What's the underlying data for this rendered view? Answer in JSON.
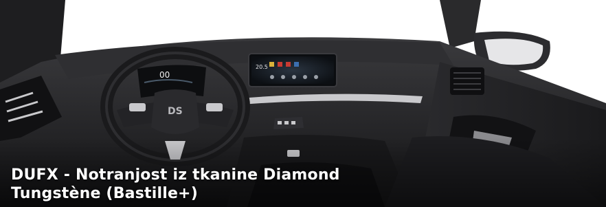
{
  "caption": {
    "line1": "DUFX - Notranjost iz tkanine Diamond",
    "line2": "Tungstène (Bastille+)"
  },
  "cluster": {
    "speed": "00"
  },
  "infotainment": {
    "temperature": "20.5"
  },
  "steering_wheel": {
    "badge": "DS"
  },
  "colors": {
    "background": "#ffffff",
    "dashboard": "#1c1c1e",
    "trim": "#c9c9cc",
    "caption_text": "#ffffff"
  }
}
